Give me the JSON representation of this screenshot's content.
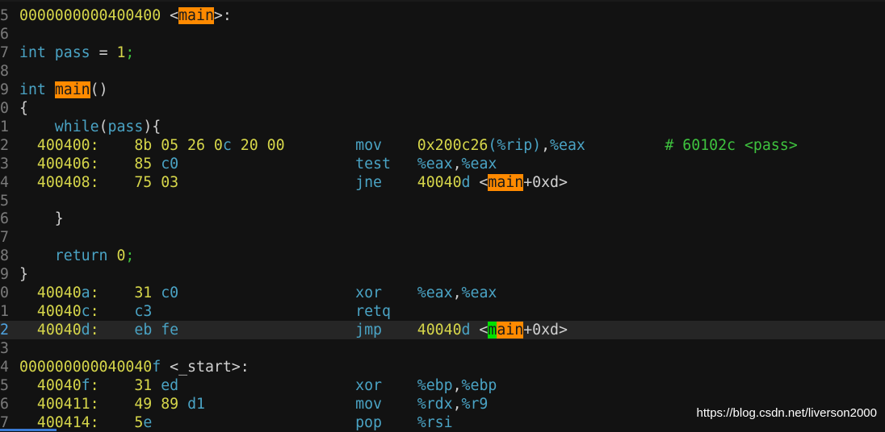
{
  "editor": {
    "lines": [
      {
        "num": "5",
        "segs": [
          {
            "t": "0000000000400400",
            "c": "c-yellow"
          },
          {
            "t": " <",
            "c": "c-white"
          },
          {
            "t": "main",
            "c": "hl-orange"
          },
          {
            "t": ">:",
            "c": "c-white"
          }
        ]
      },
      {
        "num": "6",
        "segs": []
      },
      {
        "num": "7",
        "segs": [
          {
            "t": "int",
            "c": "c-cyan"
          },
          {
            "t": " pass ",
            "c": "c-cyan"
          },
          {
            "t": "=",
            "c": "c-white"
          },
          {
            "t": " 1",
            "c": "c-num"
          },
          {
            "t": ";",
            "c": "c-green"
          }
        ]
      },
      {
        "num": "8",
        "segs": []
      },
      {
        "num": "9",
        "segs": [
          {
            "t": "int ",
            "c": "c-cyan"
          },
          {
            "t": "main",
            "c": "hl-orange"
          },
          {
            "t": "()",
            "c": "c-white"
          }
        ]
      },
      {
        "num": "0",
        "segs": [
          {
            "t": "{",
            "c": "c-white"
          }
        ]
      },
      {
        "num": "1",
        "segs": [
          {
            "t": "    while",
            "c": "c-cyan"
          },
          {
            "t": "(",
            "c": "c-white"
          },
          {
            "t": "pass",
            "c": "c-cyan"
          },
          {
            "t": "){",
            "c": "c-white"
          }
        ]
      },
      {
        "num": "2",
        "segs": [
          {
            "t": "  400400:",
            "c": "c-yellow"
          },
          {
            "t": "    8b 05 26 0",
            "c": "c-yellow"
          },
          {
            "t": "c",
            "c": "c-cyan"
          },
          {
            "t": " 20 00",
            "c": "c-yellow"
          },
          {
            "t": "        mov    ",
            "c": "c-cyan"
          },
          {
            "t": "0x200c26",
            "c": "c-yellow"
          },
          {
            "t": "(%rip)",
            "c": "c-cyan"
          },
          {
            "t": ",",
            "c": "c-white"
          },
          {
            "t": "%eax",
            "c": "c-cyan"
          },
          {
            "t": "         # 60102c <pass>",
            "c": "c-green"
          }
        ]
      },
      {
        "num": "3",
        "segs": [
          {
            "t": "  400406:",
            "c": "c-yellow"
          },
          {
            "t": "    85 ",
            "c": "c-yellow"
          },
          {
            "t": "c0",
            "c": "c-cyan"
          },
          {
            "t": "                    test   ",
            "c": "c-cyan"
          },
          {
            "t": "%eax",
            "c": "c-cyan"
          },
          {
            "t": ",",
            "c": "c-white"
          },
          {
            "t": "%eax",
            "c": "c-cyan"
          }
        ]
      },
      {
        "num": "4",
        "segs": [
          {
            "t": "  400408:",
            "c": "c-yellow"
          },
          {
            "t": "    75 03",
            "c": "c-yellow"
          },
          {
            "t": "                    jne    ",
            "c": "c-cyan"
          },
          {
            "t": "40040",
            "c": "c-yellow"
          },
          {
            "t": "d",
            "c": "c-cyan"
          },
          {
            "t": " <",
            "c": "c-white"
          },
          {
            "t": "main",
            "c": "hl-orange"
          },
          {
            "t": "+0xd>",
            "c": "c-white"
          }
        ]
      },
      {
        "num": "5",
        "segs": []
      },
      {
        "num": "6",
        "segs": [
          {
            "t": "    }",
            "c": "c-white"
          }
        ]
      },
      {
        "num": "7",
        "segs": []
      },
      {
        "num": "8",
        "segs": [
          {
            "t": "    return",
            "c": "c-cyan"
          },
          {
            "t": " 0",
            "c": "c-num"
          },
          {
            "t": ";",
            "c": "c-green"
          }
        ]
      },
      {
        "num": "9",
        "segs": [
          {
            "t": "}",
            "c": "c-white"
          }
        ]
      },
      {
        "num": "0",
        "segs": [
          {
            "t": "  40040",
            "c": "c-yellow"
          },
          {
            "t": "a",
            "c": "c-cyan"
          },
          {
            "t": ":",
            "c": "c-yellow"
          },
          {
            "t": "    31 ",
            "c": "c-yellow"
          },
          {
            "t": "c0",
            "c": "c-cyan"
          },
          {
            "t": "                    xor    ",
            "c": "c-cyan"
          },
          {
            "t": "%eax",
            "c": "c-cyan"
          },
          {
            "t": ",",
            "c": "c-white"
          },
          {
            "t": "%eax",
            "c": "c-cyan"
          }
        ]
      },
      {
        "num": "1",
        "segs": [
          {
            "t": "  40040",
            "c": "c-yellow"
          },
          {
            "t": "c",
            "c": "c-cyan"
          },
          {
            "t": ":",
            "c": "c-yellow"
          },
          {
            "t": "    ",
            "c": "c-yellow"
          },
          {
            "t": "c3",
            "c": "c-cyan"
          },
          {
            "t": "                       retq",
            "c": "c-cyan"
          }
        ]
      },
      {
        "num": "2",
        "current": true,
        "segs": [
          {
            "t": "  40040",
            "c": "c-yellow"
          },
          {
            "t": "d",
            "c": "c-cyan"
          },
          {
            "t": ":",
            "c": "c-yellow"
          },
          {
            "t": "    ",
            "c": "c-yellow"
          },
          {
            "t": "eb fe",
            "c": "c-cyan"
          },
          {
            "t": "                    jmp    ",
            "c": "c-cyan"
          },
          {
            "t": "40040",
            "c": "c-yellow"
          },
          {
            "t": "d",
            "c": "c-cyan"
          },
          {
            "t": " <",
            "c": "c-white"
          },
          {
            "t": "m",
            "c": "hl-cursor"
          },
          {
            "t": "ain",
            "c": "hl-orange"
          },
          {
            "t": "+0xd>",
            "c": "c-white"
          }
        ]
      },
      {
        "num": "3",
        "segs": []
      },
      {
        "num": "4",
        "segs": [
          {
            "t": "000000000040040",
            "c": "c-yellow"
          },
          {
            "t": "f",
            "c": "c-cyan"
          },
          {
            "t": " <_start>:",
            "c": "c-white"
          }
        ]
      },
      {
        "num": "5",
        "segs": [
          {
            "t": "  40040",
            "c": "c-yellow"
          },
          {
            "t": "f",
            "c": "c-cyan"
          },
          {
            "t": ":",
            "c": "c-yellow"
          },
          {
            "t": "    31 ",
            "c": "c-yellow"
          },
          {
            "t": "ed",
            "c": "c-cyan"
          },
          {
            "t": "                    xor    ",
            "c": "c-cyan"
          },
          {
            "t": "%ebp",
            "c": "c-cyan"
          },
          {
            "t": ",",
            "c": "c-white"
          },
          {
            "t": "%ebp",
            "c": "c-cyan"
          }
        ]
      },
      {
        "num": "6",
        "segs": [
          {
            "t": "  400411:",
            "c": "c-yellow"
          },
          {
            "t": "    49 89 ",
            "c": "c-yellow"
          },
          {
            "t": "d1",
            "c": "c-cyan"
          },
          {
            "t": "                 mov    ",
            "c": "c-cyan"
          },
          {
            "t": "%rdx",
            "c": "c-cyan"
          },
          {
            "t": ",",
            "c": "c-white"
          },
          {
            "t": "%r9",
            "c": "c-cyan"
          }
        ]
      },
      {
        "num": "7",
        "segs": [
          {
            "t": "  400414:",
            "c": "c-yellow"
          },
          {
            "t": "    5",
            "c": "c-yellow"
          },
          {
            "t": "e",
            "c": "c-cyan"
          },
          {
            "t": "                       pop    ",
            "c": "c-cyan"
          },
          {
            "t": "%rsi",
            "c": "c-cyan"
          }
        ]
      }
    ]
  },
  "watermark": "https://blog.csdn.net/liverson2000",
  "colors": {
    "background": "#121212",
    "current_line": "#262626",
    "highlight": "#ff8a00",
    "cursor": "#00e000"
  }
}
